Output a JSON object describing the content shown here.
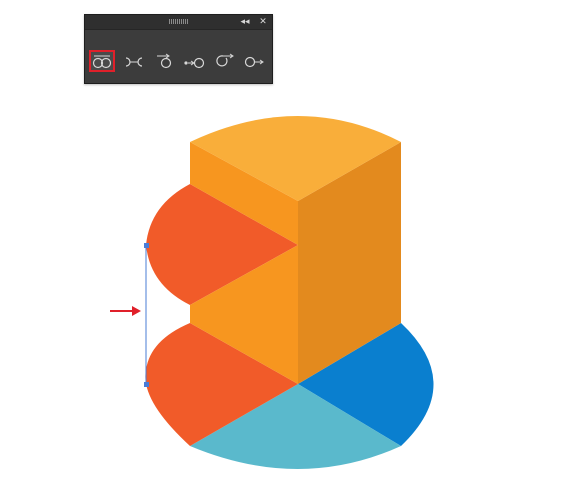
{
  "panel": {
    "header": {
      "collapse_icon": "double-chevron-left-icon",
      "close_icon": "close-icon"
    },
    "tools": [
      {
        "icon": "connect-paths-icon",
        "selected": true
      },
      {
        "icon": "join-paths-icon",
        "selected": false
      },
      {
        "icon": "start-point-icon",
        "selected": false
      },
      {
        "icon": "end-point-icon",
        "selected": false
      },
      {
        "icon": "arrow-start-icon",
        "selected": false
      },
      {
        "icon": "arrow-end-icon",
        "selected": false
      }
    ],
    "selected_highlight_color": "#e0202a"
  },
  "artwork": {
    "colors": {
      "top_yellow": "#f9ae3a",
      "front_orange": "#f7961f",
      "side_dark_orange": "#e38a1e",
      "red_orange": "#f15b29",
      "blue": "#0a7fcf",
      "light_blue": "#5ab9cc"
    },
    "selection_color": "#4a7cd6",
    "arrow_color": "#e0202a"
  }
}
